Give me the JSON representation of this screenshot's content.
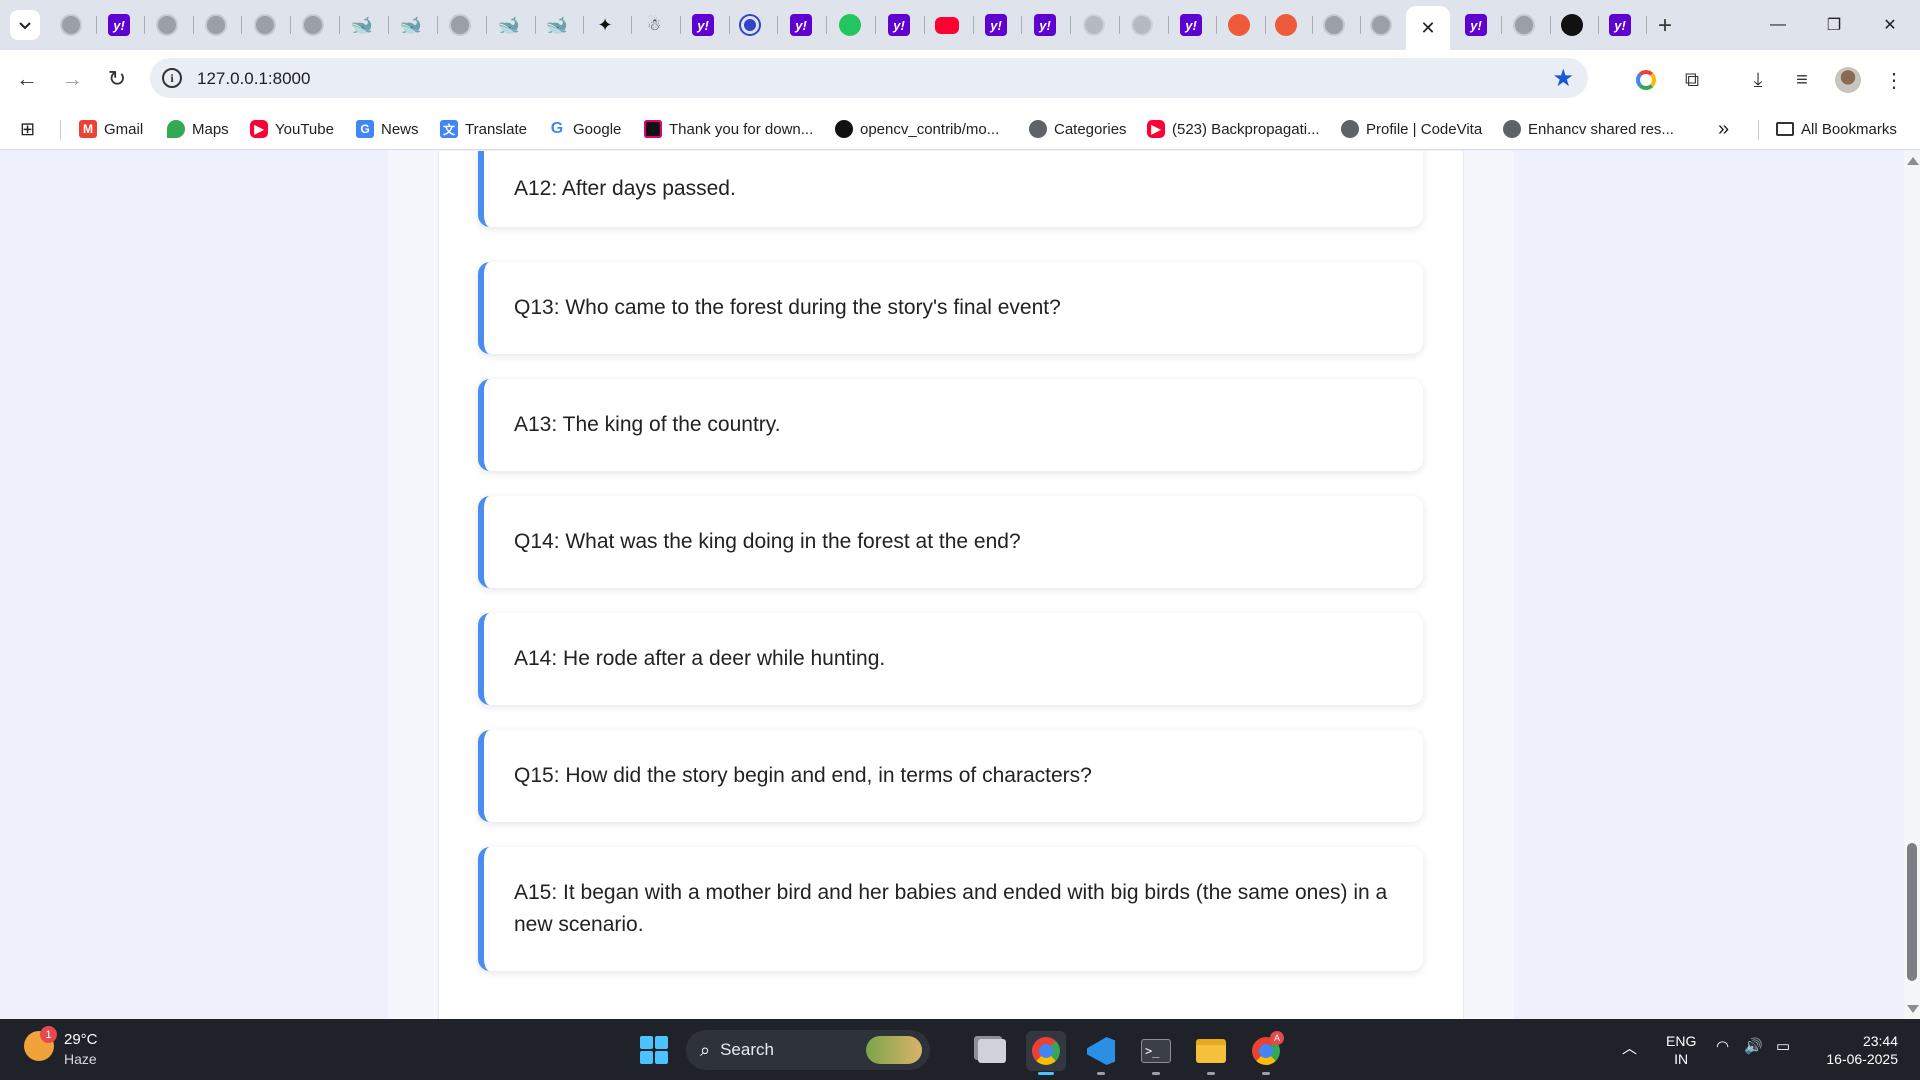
{
  "browser": {
    "active_tab_close": "✕",
    "new_tab": "+",
    "url": "127.0.0.1:8000",
    "window": {
      "minimize": "—",
      "restore": "❐",
      "close": "✕"
    }
  },
  "bookmarks": [
    {
      "label": "Gmail",
      "icon": "gmail-icon",
      "color": "#ea4335"
    },
    {
      "label": "Maps",
      "icon": "maps-icon",
      "color": "#34a853"
    },
    {
      "label": "YouTube",
      "icon": "youtube-icon",
      "color": "#ff0033"
    },
    {
      "label": "News",
      "icon": "news-icon",
      "color": "#4285f4"
    },
    {
      "label": "Translate",
      "icon": "translate-icon",
      "color": "#4285f4"
    },
    {
      "label": "Google",
      "icon": "google-icon",
      "color": "#4285f4"
    },
    {
      "label": "Thank you for down...",
      "icon": "jetbrains-icon",
      "color": "#e6007a"
    },
    {
      "label": "opencv_contrib/mo...",
      "icon": "github-icon",
      "color": "#111111"
    },
    {
      "label": "Categories",
      "icon": "globe-icon",
      "color": "#5f6368"
    },
    {
      "label": "(523) Backpropagati...",
      "icon": "youtube-icon",
      "color": "#ff0033"
    },
    {
      "label": "Profile | CodeVita",
      "icon": "globe-icon",
      "color": "#5f6368"
    },
    {
      "label": "Enhancv shared res...",
      "icon": "globe-icon",
      "color": "#5f6368"
    }
  ],
  "bookmarks_overflow": "»",
  "all_bookmarks": "All Bookmarks",
  "qa": [
    {
      "text": "A12: After days passed."
    },
    {
      "text": "Q13: Who came to the forest during the story's final event?"
    },
    {
      "text": "A13: The king of the country."
    },
    {
      "text": "Q14: What was the king doing in the forest at the end?"
    },
    {
      "text": "A14: He rode after a deer while hunting."
    },
    {
      "text": "Q15: How did the story begin and end, in terms of characters?"
    },
    {
      "text": "A15: It began with a mother bird and her babies and ended with big birds (the same ones) in a new scenario."
    }
  ],
  "colors": {
    "accent": "#4a8df0",
    "page_bg": "#eef1fb",
    "taskbar": "#1f2228"
  },
  "taskbar": {
    "weather_badge": "1",
    "temperature": "29°C",
    "condition": "Haze",
    "search_label": "Search",
    "lang_top": "ENG",
    "lang_bottom": "IN",
    "time": "23:44",
    "date": "16-06-2025",
    "chrome_badge": "A"
  }
}
